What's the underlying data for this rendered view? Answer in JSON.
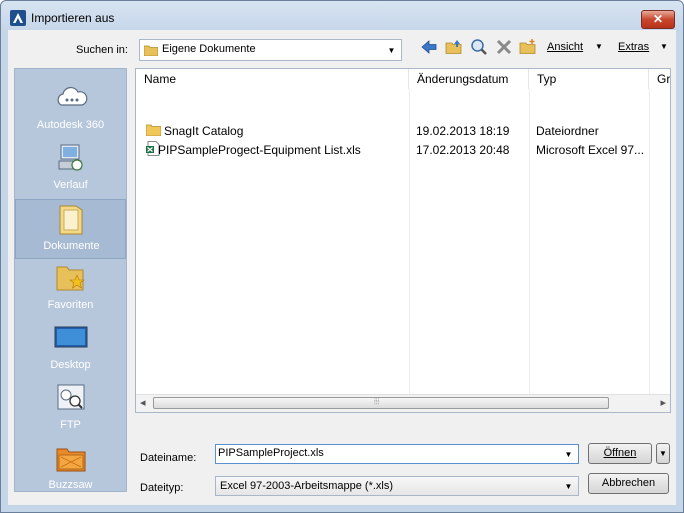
{
  "window": {
    "title": "Importieren aus",
    "close_glyph": "✕"
  },
  "toolbar": {
    "look_in_label": "Suchen in:",
    "look_in_value": "Eigene Dokumente",
    "view_label": "Ansicht",
    "tools_label": "Extras"
  },
  "places": [
    {
      "label": "Autodesk 360",
      "icon": "cloud-icon"
    },
    {
      "label": "Verlauf",
      "icon": "history-icon"
    },
    {
      "label": "Dokumente",
      "icon": "documents-icon",
      "selected": true
    },
    {
      "label": "Favoriten",
      "icon": "favorites-icon"
    },
    {
      "label": "Desktop",
      "icon": "desktop-icon"
    },
    {
      "label": "FTP",
      "icon": "ftp-icon"
    },
    {
      "label": "Buzzsaw",
      "icon": "buzzsaw-icon"
    }
  ],
  "columns": [
    "Name",
    "Änderungsdatum",
    "Typ",
    "Grö"
  ],
  "files": [
    {
      "name": "SnagIt Catalog",
      "date": "19.02.2013 18:19",
      "type": "Dateiordner",
      "icon": "folder-icon"
    },
    {
      "name": "PIPSampleProgect-Equipment List.xls",
      "date": "17.02.2013 20:48",
      "type": "Microsoft Excel 97...",
      "icon": "excel-file-icon"
    }
  ],
  "scrollbar": {
    "left_glyph": "◂",
    "right_glyph": "▸",
    "grip_glyph": "⦙⦙⦙"
  },
  "filename": {
    "label": "Dateiname:",
    "value": "PIPSampleProject.xls"
  },
  "filetype": {
    "label": "Dateityp:",
    "value": "Excel 97-2003-Arbeitsmappe (*.xls)"
  },
  "buttons": {
    "open": "Öffnen",
    "cancel": "Abbrechen"
  },
  "colors": {
    "places_bg": "#b6c7dc",
    "accent": "#3b6fb6"
  }
}
